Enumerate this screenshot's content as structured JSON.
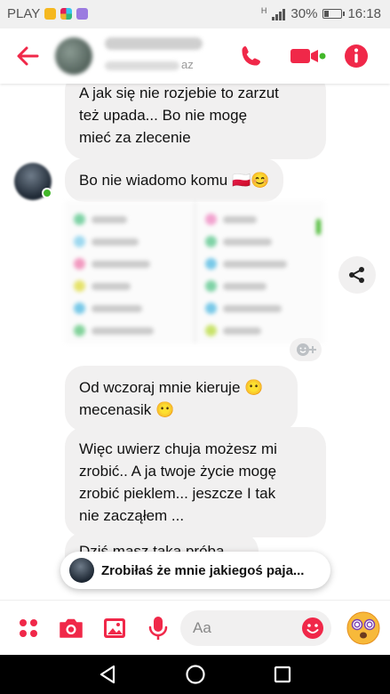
{
  "status_bar": {
    "carrier": "PLAY",
    "signal_label": "H",
    "battery_percent": "30%",
    "battery_level": 0.3,
    "time": "16:18"
  },
  "header": {
    "contact_status": "az",
    "accent_color": "#f02849"
  },
  "messages": {
    "m1_lines": [
      "A jak się nie rozjebie  to zarzut",
      "też upada...  Bo nie mogę",
      "mieć za zlecenie"
    ],
    "m2": "Bo nie wiadomo  komu 🇵🇱😊",
    "m3_lines": [
      "Od wczoraj mnie kieruje 😶",
      "mecenasik  😶"
    ],
    "m4_lines": [
      "Więc uwierz chuja możesz mi",
      "zrobić..  A ja twoje życie mogę",
      "zrobić pieklem... jeszcze I tak",
      "nie zacząłem ..."
    ],
    "m5_partial": "Dziś masz taka próba"
  },
  "toast": {
    "text": "Zrobiłaś że mnie jakiegoś paja..."
  },
  "composer": {
    "placeholder": "Aa"
  },
  "icons": {
    "back": "back-arrow-icon",
    "call": "phone-icon",
    "video": "video-camera-icon",
    "info": "info-icon",
    "share": "share-icon",
    "react": "add-reaction-icon",
    "apps": "more-apps-icon",
    "camera": "camera-icon",
    "gallery": "image-icon",
    "mic": "microphone-icon",
    "emoji": "emoji-icon",
    "quick_reaction": "face-with-spiral-eyes-icon",
    "nav_back": "nav-back-icon",
    "nav_home": "nav-home-icon",
    "nav_recent": "nav-recent-apps-icon"
  }
}
